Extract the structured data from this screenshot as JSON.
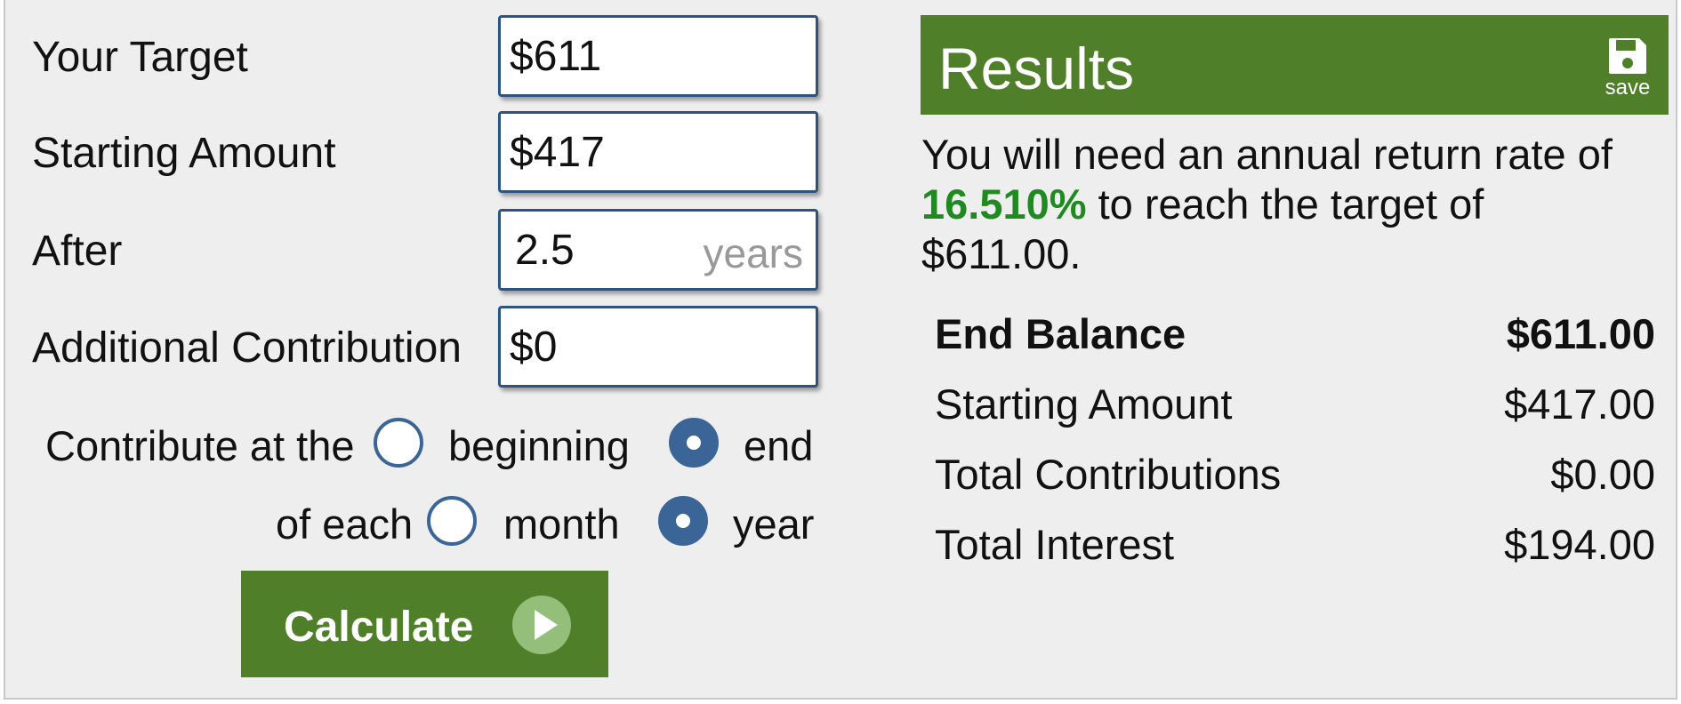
{
  "form": {
    "target_label": "Your Target",
    "target_value": "$611",
    "starting_label": "Starting Amount",
    "starting_value": "$417",
    "after_label": "After",
    "after_value": "2.5",
    "after_unit": "years",
    "contribution_label": "Additional Contribution",
    "contribution_value": "$0",
    "contribute_at_label": "Contribute at the",
    "timing_options": [
      "beginning",
      "end"
    ],
    "timing_selected": "end",
    "of_each_label": "of each",
    "period_options": [
      "month",
      "year"
    ],
    "period_selected": "year",
    "calculate_label": "Calculate"
  },
  "results": {
    "title": "Results",
    "save_label": "save",
    "summary_prefix": "You will need an annual return rate of",
    "rate": "16.510%",
    "summary_middle": "to reach the target of",
    "target": "$611.00.",
    "rows": [
      {
        "label": "End Balance",
        "value": "$611.00",
        "bold": true
      },
      {
        "label": "Starting Amount",
        "value": "$417.00"
      },
      {
        "label": "Total Contributions",
        "value": "$0.00"
      },
      {
        "label": "Total Interest",
        "value": "$194.00"
      }
    ]
  },
  "colors": {
    "accent_green": "#4f7f28",
    "rate_green": "#1f8a1f",
    "radio_blue": "#3b6597",
    "field_border": "#2d5480"
  },
  "icons": {
    "save": "floppy-disk-icon",
    "calculate": "play-circle-icon"
  }
}
